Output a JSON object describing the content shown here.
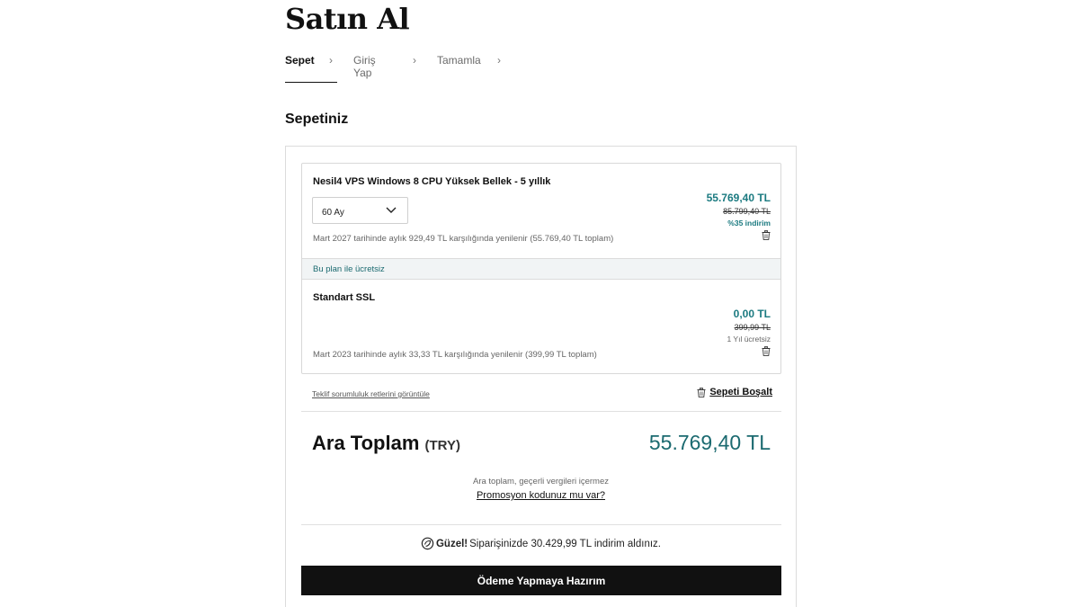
{
  "page": {
    "title": "Satın Al"
  },
  "steps": [
    {
      "label": "Sepet"
    },
    {
      "label": "Giriş Yap"
    },
    {
      "label": "Tamamla"
    }
  ],
  "cart": {
    "heading": "Sepetiniz",
    "items": [
      {
        "name": "Nesil4 VPS Windows 8 CPU Yüksek Bellek - 5 yıllık",
        "term_selected": "60 Ay",
        "price": "55.769,40 TL",
        "old_price": "85.799,40 TL",
        "discount": "%35 indirim",
        "renewal_note": "Mart 2027 tarihinde aylık 929,49 TL karşılığında yenilenir (55.769,40 TL toplam)"
      },
      {
        "band_text": "Bu plan ile ücretsiz",
        "name": "Standart SSL",
        "price": "0,00 TL",
        "old_price": "399,99 TL",
        "free_note": "1 Yıl ücretsiz",
        "renewal_note": "Mart 2023 tarihinde aylık 33,33 TL karşılığında yenilenir (399,99 TL toplam)"
      }
    ],
    "terms_link": "Teklif sorumluluk retlerini görüntüle",
    "empty_cart_label": "Sepeti Boşalt"
  },
  "summary": {
    "subtotal_label": "Ara Toplam",
    "currency": "(TRY)",
    "subtotal_value": "55.769,40 TL",
    "tax_note": "Ara toplam, geçerli vergileri içermez",
    "promo_link": "Promosyon kodunuz mu var?",
    "savings_strong": "Güzel!",
    "savings_text": "Siparişinizde 30.429,99 TL indirim aldınız.",
    "checkout_label": "Ödeme Yapmaya Hazırım"
  },
  "colors": {
    "accent": "#1b7a80",
    "button": "#111111"
  }
}
